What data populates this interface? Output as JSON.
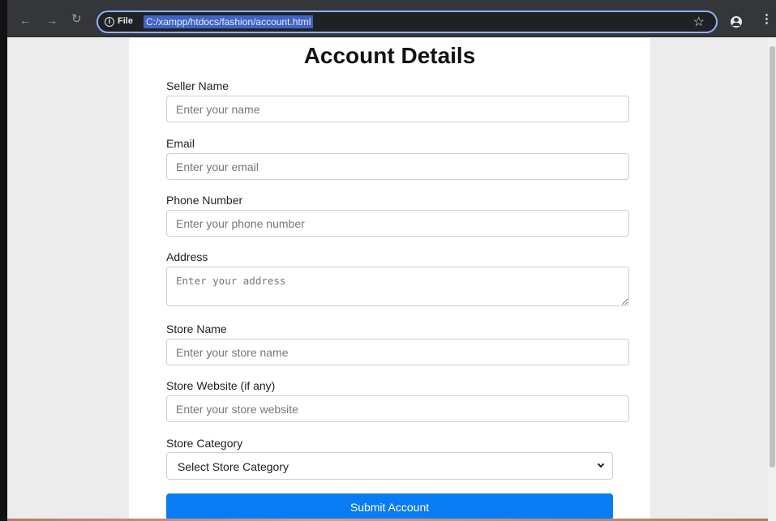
{
  "browser": {
    "file_label": "File",
    "url": "C:/xampp/htdocs/fashion/account.html",
    "icons": {
      "back": "back-arrow-icon",
      "forward": "forward-arrow-icon",
      "reload": "reload-icon",
      "info": "info-icon",
      "bookmark": "star-icon",
      "profile": "profile-icon",
      "menu": "kebab-menu-icon"
    }
  },
  "form": {
    "title": "Account Details",
    "seller_name": {
      "label": "Seller Name",
      "placeholder": "Enter your name"
    },
    "email": {
      "label": "Email",
      "placeholder": "Enter your email"
    },
    "phone": {
      "label": "Phone Number",
      "placeholder": "Enter your phone number"
    },
    "address": {
      "label": "Address",
      "placeholder": "Enter your address"
    },
    "store_name": {
      "label": "Store Name",
      "placeholder": "Enter your store name"
    },
    "store_website": {
      "label": "Store Website (if any)",
      "placeholder": "Enter your store website"
    },
    "store_category": {
      "label": "Store Category",
      "selected": "Select Store Category"
    },
    "submit_label": "Submit Account"
  },
  "colors": {
    "primary_button": "#0a7cf3",
    "card_background": "#ffffff",
    "page_background": "#ececec",
    "url_highlight": "#3f63c6"
  }
}
